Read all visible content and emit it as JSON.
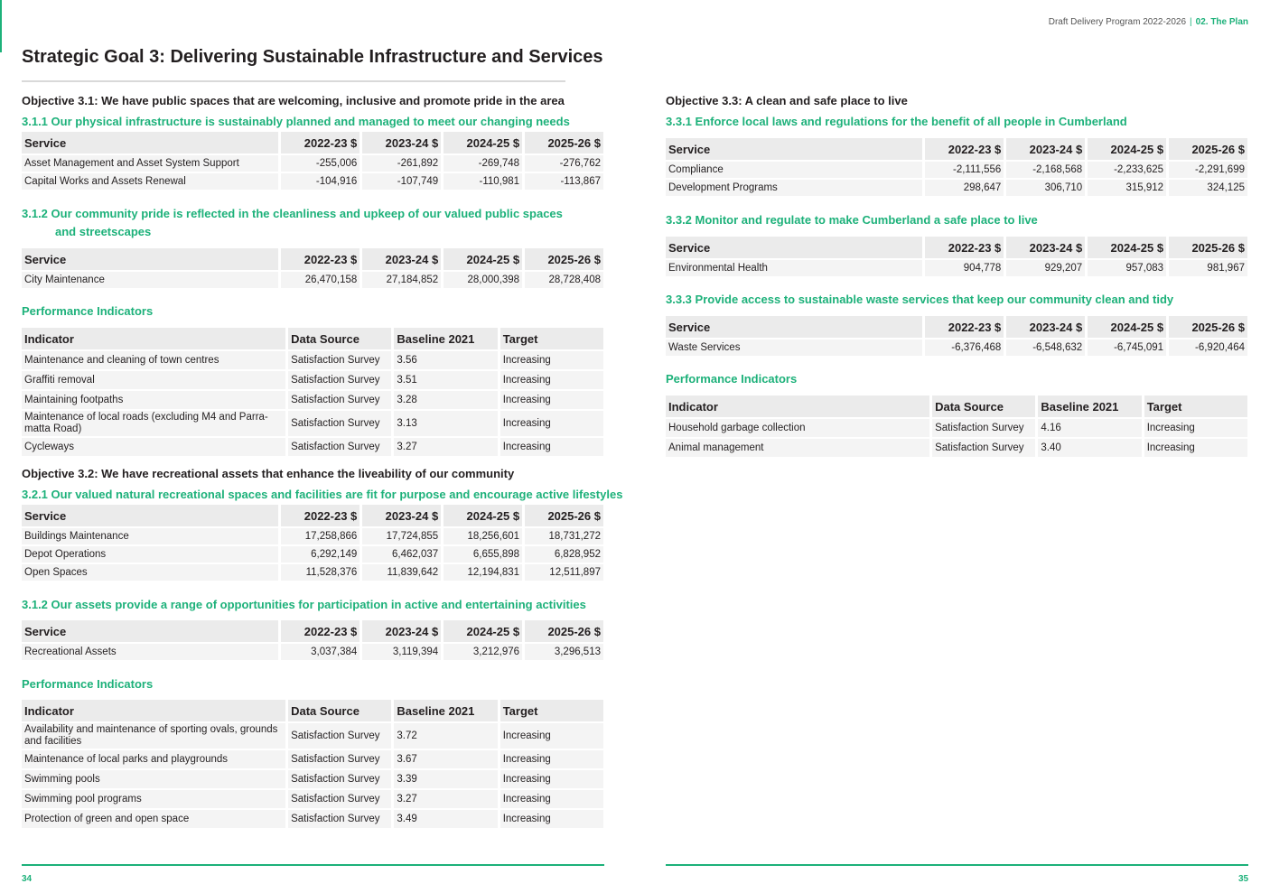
{
  "header": {
    "doc_title": "Draft Delivery Program 2022-2026",
    "separator": "|",
    "section": "02. The Plan"
  },
  "goal_title": "Strategic Goal 3: Delivering Sustainable Infrastructure and Services",
  "colors": {
    "accent": "#1db17a",
    "header_bg": "#ebebeb",
    "row_bg": "#f4f4f4"
  },
  "service_headers": [
    "Service",
    "2022-23 $",
    "2023-24 $",
    "2024-25 $",
    "2025-26 $"
  ],
  "indicator_headers": [
    "Indicator",
    "Data Source",
    "Baseline 2021",
    "Target"
  ],
  "left": {
    "obj31": "Objective 3.1: We have public spaces that are welcoming, inclusive and promote pride in the area",
    "s311": {
      "title": "3.1.1  Our physical infrastructure is sustainably planned and managed to meet our changing needs",
      "rows": [
        [
          "Asset Management and Asset System Support",
          "-255,006",
          "-261,892",
          "-269,748",
          "-276,762"
        ],
        [
          "Capital Works and Assets Renewal",
          "-104,916",
          "-107,749",
          "-110,981",
          "-113,867"
        ]
      ]
    },
    "s312": {
      "title_line1": "3.1.2  Our community pride is reflected in the cleanliness and upkeep of our valued public spaces",
      "title_line2": "and streetscapes",
      "rows": [
        [
          "City Maintenance",
          "26,470,158",
          "27,184,852",
          "28,000,398",
          "28,728,408"
        ]
      ]
    },
    "pi1": {
      "label": "Performance Indicators",
      "rows": [
        [
          "Maintenance and cleaning of town centres",
          "Satisfaction Survey",
          "3.56",
          "Increasing"
        ],
        [
          "Graffiti removal",
          "Satisfaction Survey",
          "3.51",
          "Increasing"
        ],
        [
          "Maintaining footpaths",
          "Satisfaction Survey",
          "3.28",
          "Increasing"
        ],
        [
          "Maintenance of local roads (excluding M4 and Parra-matta Road)",
          "Satisfaction Survey",
          "3.13",
          "Increasing"
        ],
        [
          "Cycleways",
          "Satisfaction Survey",
          "3.27",
          "Increasing"
        ]
      ]
    },
    "obj32": "Objective 3.2: We have recreational assets that enhance the liveability of our community",
    "s321": {
      "title": "3.2.1  Our valued natural recreational spaces and facilities are fit for purpose and encourage active lifestyles",
      "rows": [
        [
          "Buildings Maintenance",
          "17,258,866",
          "17,724,855",
          "18,256,601",
          "18,731,272"
        ],
        [
          "Depot Operations",
          "6,292,149",
          "6,462,037",
          "6,655,898",
          "6,828,952"
        ],
        [
          "Open Spaces",
          "11,528,376",
          "11,839,642",
          "12,194,831",
          "12,511,897"
        ]
      ]
    },
    "s312b": {
      "title": "3.1.2  Our assets provide a range of opportunities for participation in active and entertaining activities",
      "rows": [
        [
          "Recreational Assets",
          "3,037,384",
          "3,119,394",
          "3,212,976",
          "3,296,513"
        ]
      ]
    },
    "pi2": {
      "label": "Performance Indicators",
      "rows": [
        [
          "Availability and maintenance of sporting ovals, grounds and facilities",
          "Satisfaction Survey",
          "3.72",
          "Increasing"
        ],
        [
          "Maintenance of local parks and playgrounds",
          "Satisfaction Survey",
          "3.67",
          "Increasing"
        ],
        [
          "Swimming pools",
          "Satisfaction Survey",
          "3.39",
          "Increasing"
        ],
        [
          "Swimming pool programs",
          "Satisfaction Survey",
          "3.27",
          "Increasing"
        ],
        [
          "Protection of green and open space",
          "Satisfaction Survey",
          "3.49",
          "Increasing"
        ]
      ]
    },
    "page_number": "34"
  },
  "right": {
    "obj33": "Objective 3.3: A clean and safe place to live",
    "s331": {
      "title": "3.3.1  Enforce local laws and regulations for the benefit of all people in Cumberland",
      "rows": [
        [
          "Compliance",
          "-2,111,556",
          "-2,168,568",
          "-2,233,625",
          "-2,291,699"
        ],
        [
          "Development Programs",
          "298,647",
          "306,710",
          "315,912",
          "324,125"
        ]
      ]
    },
    "s332": {
      "title": "3.3.2  Monitor and regulate to make Cumberland a safe place to live",
      "rows": [
        [
          "Environmental Health",
          "904,778",
          "929,207",
          "957,083",
          "981,967"
        ]
      ]
    },
    "s333": {
      "title": "3.3.3  Provide access to sustainable waste services that keep our community clean and tidy",
      "rows": [
        [
          "Waste Services",
          "-6,376,468",
          "-6,548,632",
          "-6,745,091",
          "-6,920,464"
        ]
      ]
    },
    "pi3": {
      "label": "Performance Indicators",
      "rows": [
        [
          "Household garbage collection",
          "Satisfaction Survey",
          "4.16",
          "Increasing"
        ],
        [
          "Animal management",
          "Satisfaction Survey",
          "3.40",
          "Increasing"
        ]
      ]
    },
    "page_number": "35"
  }
}
